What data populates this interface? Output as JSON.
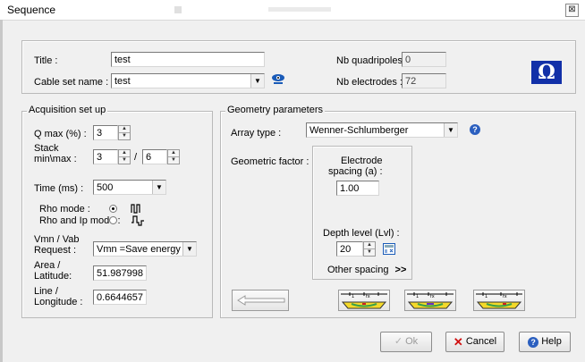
{
  "window": {
    "title": "Sequence",
    "close_glyph": "⊠"
  },
  "header": {
    "title_label": "Title :",
    "title_value": "test",
    "cable_label": "Cable set name :",
    "cable_value": "test",
    "nb_quadripoles_label": "Nb quadripoles :",
    "nb_quadripoles_value": "0",
    "nb_electrodes_label": "Nb electrodes :",
    "nb_electrodes_value": "72",
    "logo": "Ω"
  },
  "acquisition": {
    "group_title": "Acquisition set up",
    "qmax_label": "Q max (%) :",
    "qmax_value": "3",
    "stack_label_1": "Stack",
    "stack_label_2": "min\\max :",
    "stack_min": "3",
    "stack_sep": "/",
    "stack_max": "6",
    "time_label": "Time (ms) :",
    "time_value": "500",
    "rho_mode_label": "Rho mode :",
    "rho_ip_mode_label": "Rho and Ip mode :",
    "rho_mode_selected": "rho",
    "vmn_label_1": "Vmn / Vab",
    "vmn_label_2": "Request :",
    "vmn_value": "Vmn =Save energy",
    "area_label_1": "Area /",
    "area_label_2": "Latitude:",
    "area_value": "51.987998",
    "line_label_1": "Line /",
    "line_label_2": "Longitude :",
    "line_value": "0.6644657"
  },
  "geometry": {
    "group_title": "Geometry parameters",
    "array_type_label": "Array type :",
    "array_type_value": "Wenner-Schlumberger",
    "geometric_factor_label": "Geometric factor :",
    "electrode_spacing_label_1": "Electrode",
    "electrode_spacing_label_2": "spacing  (a) :",
    "electrode_spacing_value": "1.00",
    "depth_level_label": "Depth level  (Lvl) :",
    "depth_level_value": "20",
    "other_spacing_label": "Other spacing",
    "other_spacing_glyph": ">>"
  },
  "footer": {
    "ok_label": "Ok",
    "cancel_label": "Cancel",
    "help_label": "Help"
  },
  "colors": {
    "brand": "#1230a8",
    "cancel_x": "#d01010",
    "help_icon": "#2b5fbf"
  }
}
